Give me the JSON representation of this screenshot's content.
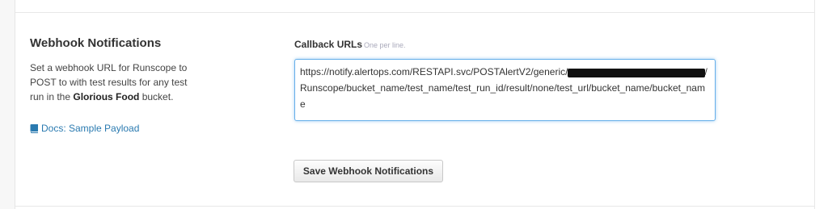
{
  "webhook": {
    "title": "Webhook Notifications",
    "description_before": "Set a webhook URL for Runscope to POST to with test results for any test run in the ",
    "bucket_name": "Glorious Food",
    "description_after": " bucket.",
    "docs_link_label": "Docs: Sample Payload"
  },
  "callback": {
    "label": "Callback URLs",
    "hint": "One per line.",
    "url_prefix": "https://notify.alertops.com/RESTAPI.svc/POSTAlertV2/generic/",
    "url_suffix": "/Runscope/bucket_name/test_name/test_run_id/result/none/test_url/bucket_name/bucket_name"
  },
  "actions": {
    "save_label": "Save Webhook Notifications"
  },
  "colors": {
    "link": "#2a7ab0",
    "focus_border": "#66afe9"
  },
  "icons": {
    "docs": "book-icon"
  }
}
